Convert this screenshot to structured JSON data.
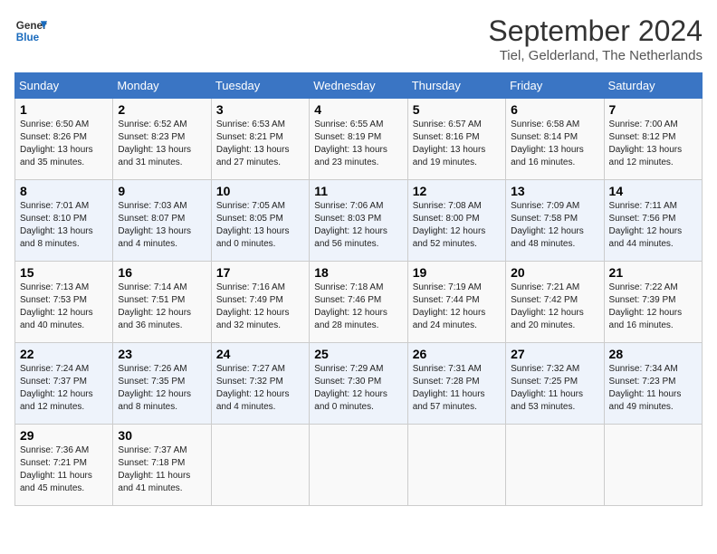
{
  "logo": {
    "line1": "General",
    "line2": "Blue"
  },
  "title": "September 2024",
  "subtitle": "Tiel, Gelderland, The Netherlands",
  "weekdays": [
    "Sunday",
    "Monday",
    "Tuesday",
    "Wednesday",
    "Thursday",
    "Friday",
    "Saturday"
  ],
  "weeks": [
    [
      {
        "day": "1",
        "info": "Sunrise: 6:50 AM\nSunset: 8:26 PM\nDaylight: 13 hours\nand 35 minutes."
      },
      {
        "day": "2",
        "info": "Sunrise: 6:52 AM\nSunset: 8:23 PM\nDaylight: 13 hours\nand 31 minutes."
      },
      {
        "day": "3",
        "info": "Sunrise: 6:53 AM\nSunset: 8:21 PM\nDaylight: 13 hours\nand 27 minutes."
      },
      {
        "day": "4",
        "info": "Sunrise: 6:55 AM\nSunset: 8:19 PM\nDaylight: 13 hours\nand 23 minutes."
      },
      {
        "day": "5",
        "info": "Sunrise: 6:57 AM\nSunset: 8:16 PM\nDaylight: 13 hours\nand 19 minutes."
      },
      {
        "day": "6",
        "info": "Sunrise: 6:58 AM\nSunset: 8:14 PM\nDaylight: 13 hours\nand 16 minutes."
      },
      {
        "day": "7",
        "info": "Sunrise: 7:00 AM\nSunset: 8:12 PM\nDaylight: 13 hours\nand 12 minutes."
      }
    ],
    [
      {
        "day": "8",
        "info": "Sunrise: 7:01 AM\nSunset: 8:10 PM\nDaylight: 13 hours\nand 8 minutes."
      },
      {
        "day": "9",
        "info": "Sunrise: 7:03 AM\nSunset: 8:07 PM\nDaylight: 13 hours\nand 4 minutes."
      },
      {
        "day": "10",
        "info": "Sunrise: 7:05 AM\nSunset: 8:05 PM\nDaylight: 13 hours\nand 0 minutes."
      },
      {
        "day": "11",
        "info": "Sunrise: 7:06 AM\nSunset: 8:03 PM\nDaylight: 12 hours\nand 56 minutes."
      },
      {
        "day": "12",
        "info": "Sunrise: 7:08 AM\nSunset: 8:00 PM\nDaylight: 12 hours\nand 52 minutes."
      },
      {
        "day": "13",
        "info": "Sunrise: 7:09 AM\nSunset: 7:58 PM\nDaylight: 12 hours\nand 48 minutes."
      },
      {
        "day": "14",
        "info": "Sunrise: 7:11 AM\nSunset: 7:56 PM\nDaylight: 12 hours\nand 44 minutes."
      }
    ],
    [
      {
        "day": "15",
        "info": "Sunrise: 7:13 AM\nSunset: 7:53 PM\nDaylight: 12 hours\nand 40 minutes."
      },
      {
        "day": "16",
        "info": "Sunrise: 7:14 AM\nSunset: 7:51 PM\nDaylight: 12 hours\nand 36 minutes."
      },
      {
        "day": "17",
        "info": "Sunrise: 7:16 AM\nSunset: 7:49 PM\nDaylight: 12 hours\nand 32 minutes."
      },
      {
        "day": "18",
        "info": "Sunrise: 7:18 AM\nSunset: 7:46 PM\nDaylight: 12 hours\nand 28 minutes."
      },
      {
        "day": "19",
        "info": "Sunrise: 7:19 AM\nSunset: 7:44 PM\nDaylight: 12 hours\nand 24 minutes."
      },
      {
        "day": "20",
        "info": "Sunrise: 7:21 AM\nSunset: 7:42 PM\nDaylight: 12 hours\nand 20 minutes."
      },
      {
        "day": "21",
        "info": "Sunrise: 7:22 AM\nSunset: 7:39 PM\nDaylight: 12 hours\nand 16 minutes."
      }
    ],
    [
      {
        "day": "22",
        "info": "Sunrise: 7:24 AM\nSunset: 7:37 PM\nDaylight: 12 hours\nand 12 minutes."
      },
      {
        "day": "23",
        "info": "Sunrise: 7:26 AM\nSunset: 7:35 PM\nDaylight: 12 hours\nand 8 minutes."
      },
      {
        "day": "24",
        "info": "Sunrise: 7:27 AM\nSunset: 7:32 PM\nDaylight: 12 hours\nand 4 minutes."
      },
      {
        "day": "25",
        "info": "Sunrise: 7:29 AM\nSunset: 7:30 PM\nDaylight: 12 hours\nand 0 minutes."
      },
      {
        "day": "26",
        "info": "Sunrise: 7:31 AM\nSunset: 7:28 PM\nDaylight: 11 hours\nand 57 minutes."
      },
      {
        "day": "27",
        "info": "Sunrise: 7:32 AM\nSunset: 7:25 PM\nDaylight: 11 hours\nand 53 minutes."
      },
      {
        "day": "28",
        "info": "Sunrise: 7:34 AM\nSunset: 7:23 PM\nDaylight: 11 hours\nand 49 minutes."
      }
    ],
    [
      {
        "day": "29",
        "info": "Sunrise: 7:36 AM\nSunset: 7:21 PM\nDaylight: 11 hours\nand 45 minutes."
      },
      {
        "day": "30",
        "info": "Sunrise: 7:37 AM\nSunset: 7:18 PM\nDaylight: 11 hours\nand 41 minutes."
      },
      {
        "day": "",
        "info": ""
      },
      {
        "day": "",
        "info": ""
      },
      {
        "day": "",
        "info": ""
      },
      {
        "day": "",
        "info": ""
      },
      {
        "day": "",
        "info": ""
      }
    ]
  ]
}
